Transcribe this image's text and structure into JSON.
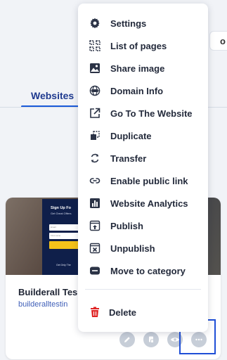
{
  "header": {
    "chip_label": "o"
  },
  "tabs": {
    "websites_label": "Websites"
  },
  "card": {
    "name": "Builderall Tes",
    "url": "builderalltestin",
    "thumbnail": {
      "title": "Sign Up Fo",
      "subtitle": "Get Great Offers",
      "field1": "Email",
      "field2": "First name",
      "footer": "Get Only The"
    }
  },
  "menu": {
    "items": [
      {
        "label": "Settings",
        "icon": "gear-icon"
      },
      {
        "label": "List of pages",
        "icon": "pages-icon"
      },
      {
        "label": "Share image",
        "icon": "image-icon"
      },
      {
        "label": "Domain Info",
        "icon": "dns-icon"
      },
      {
        "label": "Go To The Website",
        "icon": "external-link-icon"
      },
      {
        "label": "Duplicate",
        "icon": "duplicate-icon"
      },
      {
        "label": "Transfer",
        "icon": "transfer-icon"
      },
      {
        "label": "Enable public link",
        "icon": "link-icon"
      },
      {
        "label": "Website Analytics",
        "icon": "analytics-icon"
      },
      {
        "label": "Publish",
        "icon": "publish-icon"
      },
      {
        "label": "Unpublish",
        "icon": "unpublish-icon"
      },
      {
        "label": "Move to category",
        "icon": "category-icon"
      }
    ],
    "delete_label": "Delete"
  },
  "colors": {
    "accent": "#1a5ad9",
    "delete": "#e02424",
    "highlight": "#1f4fd6",
    "icon": "#2b3346"
  }
}
